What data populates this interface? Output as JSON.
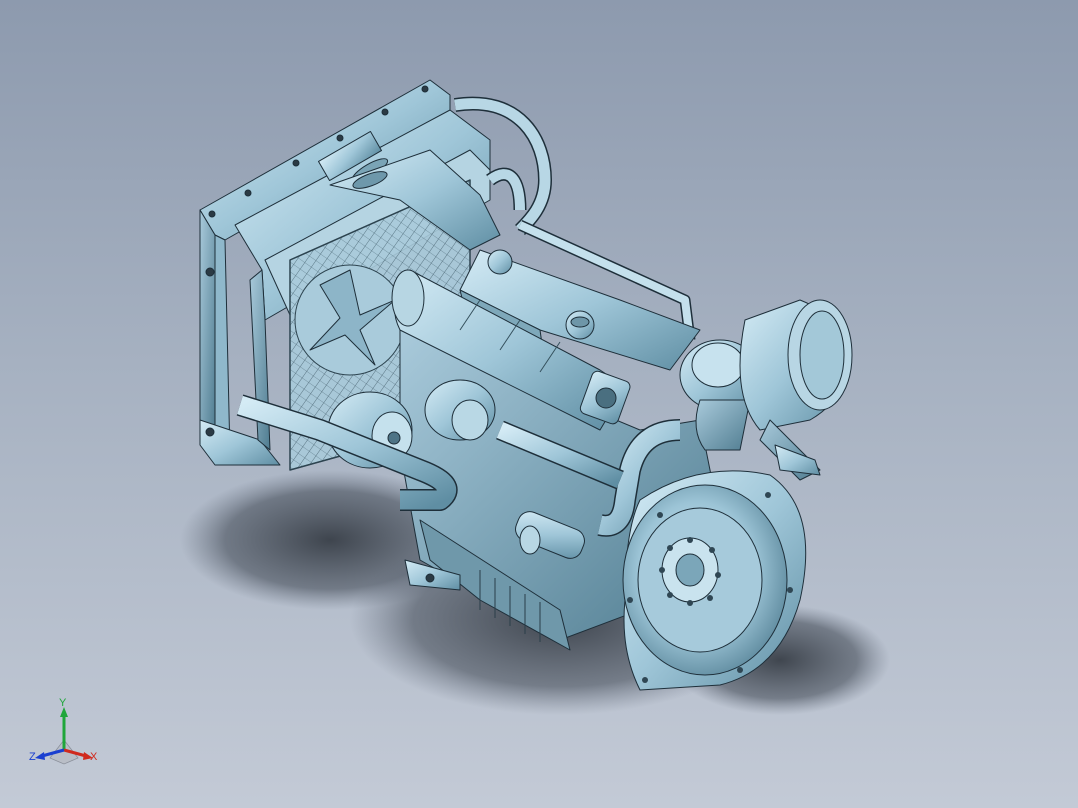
{
  "viewport": {
    "background_top": "#8d9aae",
    "background_bottom": "#c3cad6",
    "model_color": "#9fc6d8",
    "edge_color": "#1e2f3a"
  },
  "triad": {
    "x_label": "X",
    "y_label": "Y",
    "z_label": "Z",
    "x_color": "#d02a1e",
    "y_color": "#1fa63a",
    "z_color": "#1a3fd0"
  }
}
